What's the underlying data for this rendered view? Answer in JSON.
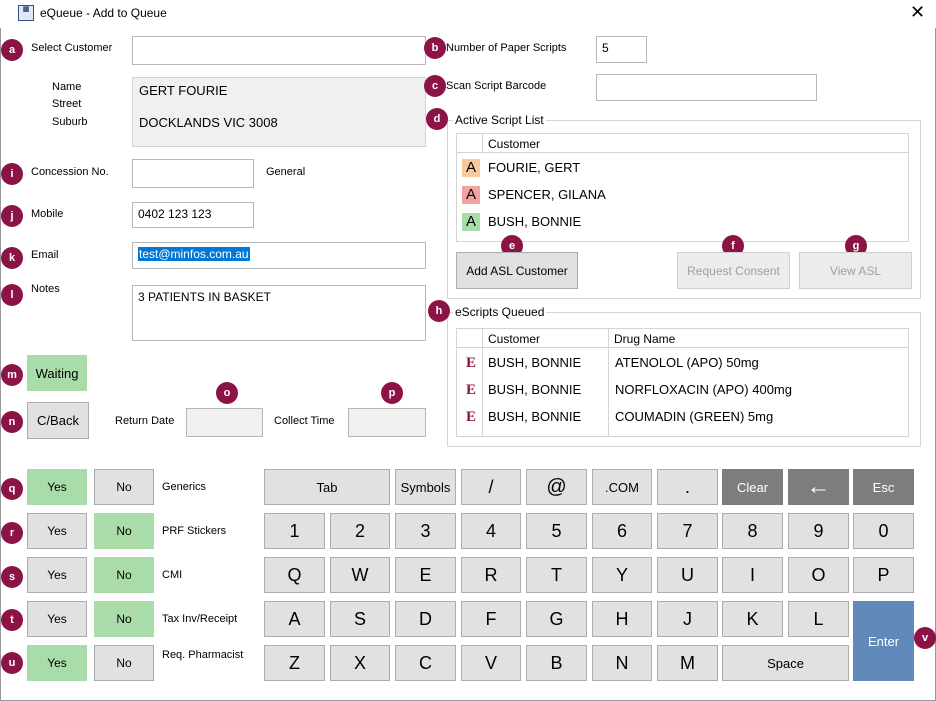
{
  "window": {
    "title": "eQueue - Add to Queue",
    "close_label": "✕"
  },
  "badges": {
    "a": "a",
    "b": "b",
    "c": "c",
    "d": "d",
    "e": "e",
    "f": "f",
    "g": "g",
    "h": "h",
    "i": "i",
    "j": "j",
    "k": "k",
    "l": "l",
    "m": "m",
    "n": "n",
    "o": "o",
    "p": "p",
    "q": "q",
    "r": "r",
    "s": "s",
    "t": "t",
    "u": "u",
    "v": "v"
  },
  "customer": {
    "select_label": "Select Customer",
    "select_value": "",
    "name_label": "Name",
    "street_label": "Street",
    "suburb_label": "Suburb",
    "name_value": "GERT FOURIE",
    "suburb_value": "DOCKLANDS VIC 3008",
    "concession_label": "Concession No.",
    "concession_value": "",
    "concession_type": "General",
    "mobile_label": "Mobile",
    "mobile_value": "0402 123 123",
    "email_label": "Email",
    "email_value": "test@minfos.com.au",
    "notes_label": "Notes",
    "notes_value": "3 PATIENTS IN BASKET"
  },
  "scripts": {
    "paper_label": "Number of Paper Scripts",
    "paper_value": "5",
    "barcode_label": "Scan Script Barcode",
    "barcode_value": ""
  },
  "active_list": {
    "title": "Active Script List",
    "col_customer": "Customer",
    "rows": [
      {
        "tag": "A",
        "customer": "FOURIE, GERT",
        "color": "#f9c89b"
      },
      {
        "tag": "A",
        "customer": "SPENCER, GILANA",
        "color": "#f2a3a3"
      },
      {
        "tag": "A",
        "customer": "BUSH, BONNIE",
        "color": "#aadcaa"
      }
    ],
    "add_asl_label": "Add ASL Customer",
    "request_consent_label": "Request Consent",
    "view_asl_label": "View ASL"
  },
  "escripts": {
    "title": "eScripts Queued",
    "col_customer": "Customer",
    "col_drug": "Drug Name",
    "rows": [
      {
        "tag": "E",
        "customer": "BUSH, BONNIE",
        "drug": "ATENOLOL (APO) 50mg"
      },
      {
        "tag": "E",
        "customer": "BUSH, BONNIE",
        "drug": "NORFLOXACIN (APO) 400mg"
      },
      {
        "tag": "E",
        "customer": "BUSH, BONNIE",
        "drug": "COUMADIN (GREEN) 5mg"
      }
    ],
    "tag_color": "#8c1346"
  },
  "status": {
    "waiting_label": "Waiting",
    "callback_label": "C/Back",
    "return_date_label": "Return Date",
    "return_date_value": "",
    "collect_time_label": "Collect Time",
    "collect_time_value": ""
  },
  "options": [
    {
      "label": "Generics",
      "yes": "Yes",
      "no": "No",
      "selected": "yes"
    },
    {
      "label": "PRF Stickers",
      "yes": "Yes",
      "no": "No",
      "selected": "no"
    },
    {
      "label": "CMI",
      "yes": "Yes",
      "no": "No",
      "selected": "no"
    },
    {
      "label": "Tax Inv/Receipt",
      "yes": "Yes",
      "no": "No",
      "selected": "no"
    },
    {
      "label": "Req. Pharmacist",
      "yes": "Yes",
      "no": "No",
      "selected": "yes"
    }
  ],
  "keyboard": {
    "row1": [
      "Tab",
      "Symbols",
      "/",
      "@",
      ".COM",
      ".",
      "Clear",
      "←",
      "Esc"
    ],
    "row2": [
      "1",
      "2",
      "3",
      "4",
      "5",
      "6",
      "7",
      "8",
      "9",
      "0"
    ],
    "row3": [
      "Q",
      "W",
      "E",
      "R",
      "T",
      "Y",
      "U",
      "I",
      "O",
      "P"
    ],
    "row4": [
      "A",
      "S",
      "D",
      "F",
      "G",
      "H",
      "J",
      "K",
      "L"
    ],
    "row5": [
      "Z",
      "X",
      "C",
      "V",
      "B",
      "N",
      "M"
    ],
    "space_label": "Space",
    "enter_label": "Enter"
  },
  "colors": {
    "badge": "#8c1346",
    "selected_green": "#aadcaa",
    "enter_blue": "#6189b9",
    "dark_key": "#7d7d7d",
    "email_highlight": "#0078d7"
  }
}
